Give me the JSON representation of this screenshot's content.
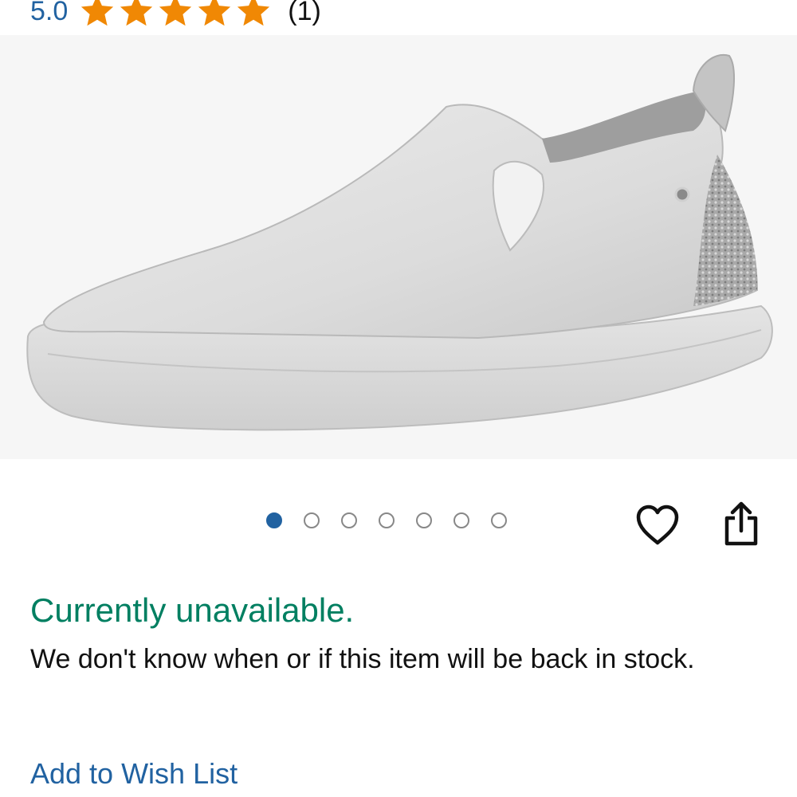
{
  "rating": {
    "value": "5.0",
    "stars": 5,
    "star_color": "#f08804",
    "count": "(1)"
  },
  "product_image": {
    "icon": "shoe-image",
    "background": "#f6f6f6"
  },
  "carousel": {
    "total": 7,
    "active_index": 0,
    "active_color": "#2162a1"
  },
  "actions": {
    "wishlist_icon": "heart-icon",
    "share_icon": "share-icon"
  },
  "availability": {
    "status": "Currently unavailable.",
    "status_color": "#007f61",
    "message": "We don't know when or if this item will be back in stock."
  },
  "links": {
    "add_to_wish_list": "Add to Wish List",
    "link_color": "#2162a1"
  }
}
